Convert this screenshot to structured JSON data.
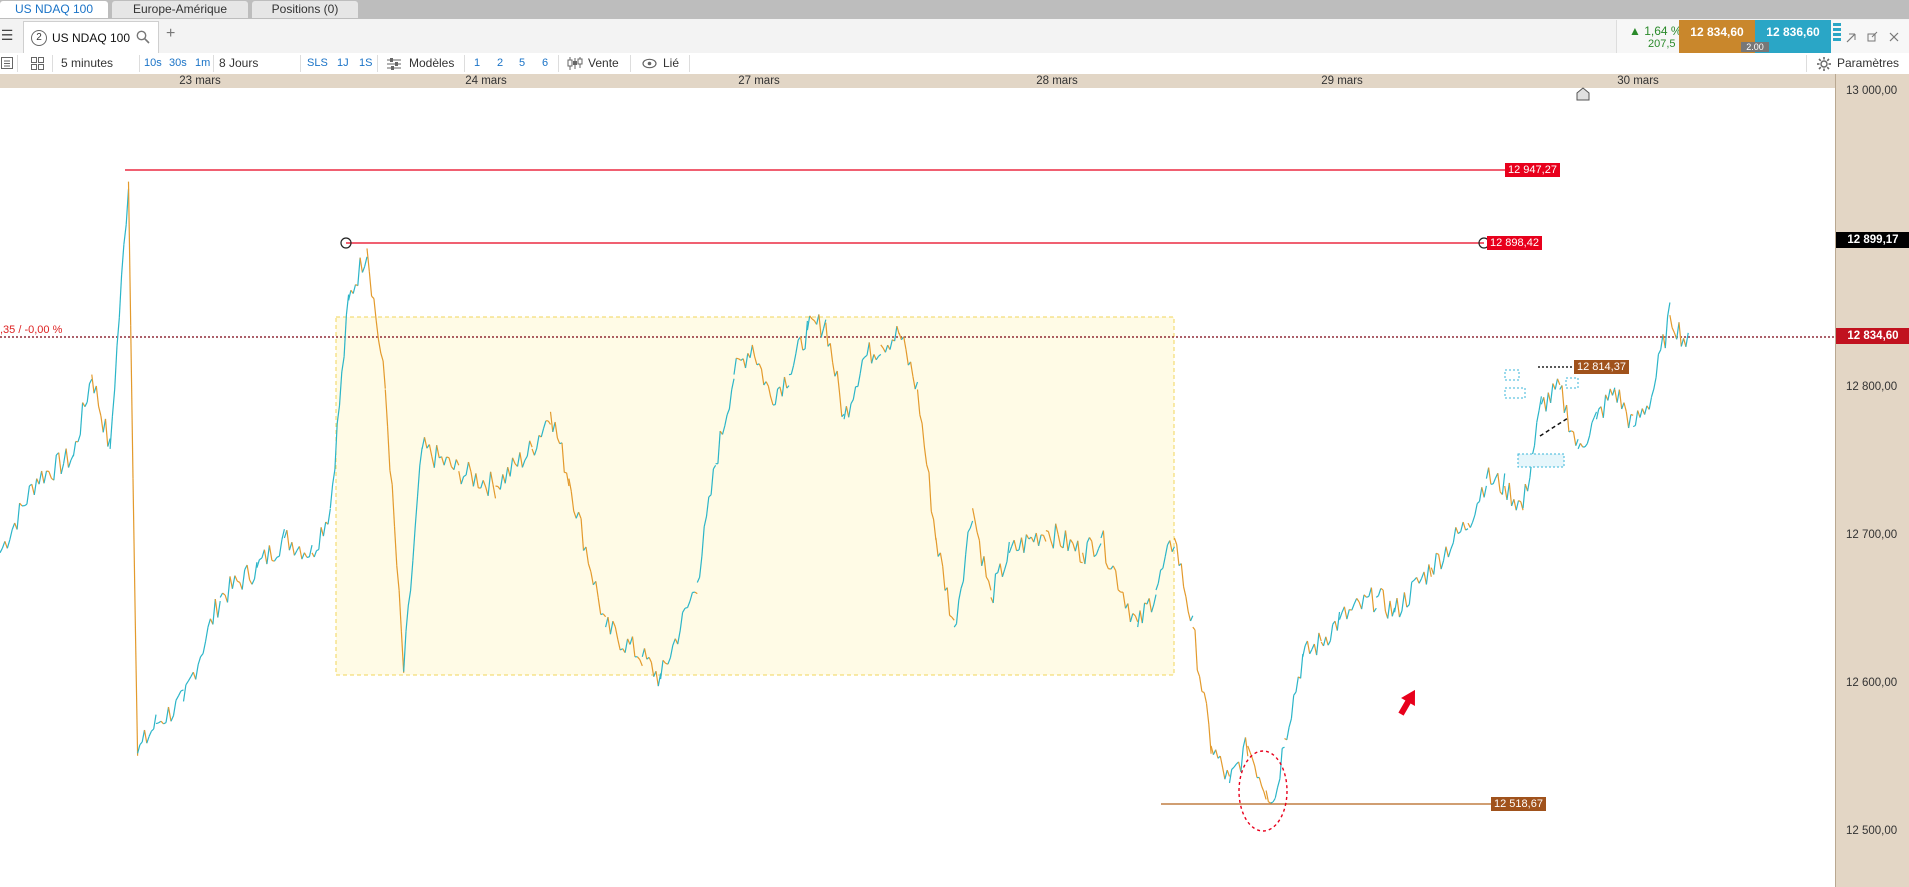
{
  "tabs": [
    {
      "label": "US NDAQ 100",
      "active": true
    },
    {
      "label": "Europe-Amérique",
      "active": false
    },
    {
      "label": "Positions (0)",
      "active": false
    }
  ],
  "instrument": {
    "number": "2",
    "name": "US NDAQ 100",
    "change_pct": "▲ 1,64 %",
    "change_pts": "207,5",
    "bid": "12 834,60",
    "ask": "12 836,60",
    "spread": "2.00"
  },
  "toolbar": {
    "interval": "5 minutes",
    "quick_intervals": [
      "10s",
      "30s",
      "1m"
    ],
    "range": "8 Jours",
    "range_buttons": [
      "SLS",
      "1J",
      "1S"
    ],
    "models_label": "Modèles",
    "layout_buttons": [
      "1",
      "2",
      "5",
      "6"
    ],
    "sell_label": "Vente",
    "linked_label": "Lié",
    "settings_label": "Paramètres"
  },
  "colors": {
    "up": "#2bb5c8",
    "down": "#e39a2c",
    "resistance": "#e8001c",
    "support": "#b5651d",
    "current": "#c1121f"
  },
  "left_note": ",35 / -0,00 %",
  "chart_data": {
    "type": "candlestick-line",
    "x_dates": [
      "23 mars",
      "24 mars",
      "27 mars",
      "28 mars",
      "29 mars",
      "30 mars"
    ],
    "y_ticks": [
      "13 000,00",
      "12 900,00",
      "12 800,00",
      "12 700,00",
      "12 600,00",
      "12 500,00"
    ],
    "y_tick_values": [
      13000,
      12900,
      12800,
      12700,
      12600,
      12500
    ],
    "ylim": [
      12465,
      13003
    ],
    "current_price": {
      "value": 12834.6,
      "label": "12 834,60"
    },
    "crosshair_price": {
      "value": 12899.17,
      "label": "12 899,17"
    },
    "levels": [
      {
        "value": 12947.27,
        "label": "12 947,27",
        "kind": "resistance"
      },
      {
        "value": 12898.42,
        "label": "12 898,42",
        "kind": "resistance"
      },
      {
        "value": 12814.37,
        "label": "12 814,37",
        "kind": "support-dotted"
      },
      {
        "value": 12518.67,
        "label": "12 518,67",
        "kind": "support"
      }
    ],
    "range_box": {
      "y_high": 12848,
      "y_low": 12605
    },
    "price_path": [
      [
        0,
        12690
      ],
      [
        0.02,
        12740
      ],
      [
        0.04,
        12755
      ],
      [
        0.05,
        12810
      ],
      [
        0.06,
        12760
      ],
      [
        0.07,
        12940
      ],
      [
        0.075,
        12555
      ],
      [
        0.085,
        12575
      ],
      [
        0.1,
        12590
      ],
      [
        0.12,
        12660
      ],
      [
        0.14,
        12680
      ],
      [
        0.155,
        12700
      ],
      [
        0.17,
        12690
      ],
      [
        0.18,
        12720
      ],
      [
        0.19,
        12860
      ],
      [
        0.2,
        12895
      ],
      [
        0.21,
        12800
      ],
      [
        0.22,
        12610
      ],
      [
        0.23,
        12760
      ],
      [
        0.25,
        12745
      ],
      [
        0.27,
        12735
      ],
      [
        0.29,
        12760
      ],
      [
        0.3,
        12785
      ],
      [
        0.31,
        12740
      ],
      [
        0.33,
        12640
      ],
      [
        0.35,
        12620
      ],
      [
        0.36,
        12605
      ],
      [
        0.38,
        12670
      ],
      [
        0.39,
        12750
      ],
      [
        0.4,
        12810
      ],
      [
        0.41,
        12830
      ],
      [
        0.42,
        12795
      ],
      [
        0.43,
        12810
      ],
      [
        0.44,
        12840
      ],
      [
        0.45,
        12845
      ],
      [
        0.46,
        12780
      ],
      [
        0.47,
        12820
      ],
      [
        0.48,
        12830
      ],
      [
        0.49,
        12838
      ],
      [
        0.5,
        12800
      ],
      [
        0.51,
        12700
      ],
      [
        0.52,
        12640
      ],
      [
        0.53,
        12720
      ],
      [
        0.54,
        12660
      ],
      [
        0.55,
        12690
      ],
      [
        0.57,
        12705
      ],
      [
        0.59,
        12690
      ],
      [
        0.6,
        12700
      ],
      [
        0.62,
        12640
      ],
      [
        0.63,
        12665
      ],
      [
        0.64,
        12700
      ],
      [
        0.65,
        12640
      ],
      [
        0.66,
        12560
      ],
      [
        0.67,
        12535
      ],
      [
        0.68,
        12560
      ],
      [
        0.69,
        12530
      ],
      [
        0.695,
        12525
      ],
      [
        0.7,
        12565
      ],
      [
        0.71,
        12620
      ],
      [
        0.72,
        12630
      ],
      [
        0.73,
        12645
      ],
      [
        0.75,
        12660
      ],
      [
        0.76,
        12650
      ],
      [
        0.78,
        12680
      ],
      [
        0.8,
        12710
      ],
      [
        0.81,
        12740
      ],
      [
        0.82,
        12735
      ],
      [
        0.83,
        12720
      ],
      [
        0.84,
        12790
      ],
      [
        0.85,
        12800
      ],
      [
        0.86,
        12760
      ],
      [
        0.87,
        12780
      ],
      [
        0.88,
        12800
      ],
      [
        0.89,
        12775
      ],
      [
        0.9,
        12795
      ],
      [
        0.91,
        12850
      ],
      [
        0.92,
        12830
      ]
    ]
  }
}
